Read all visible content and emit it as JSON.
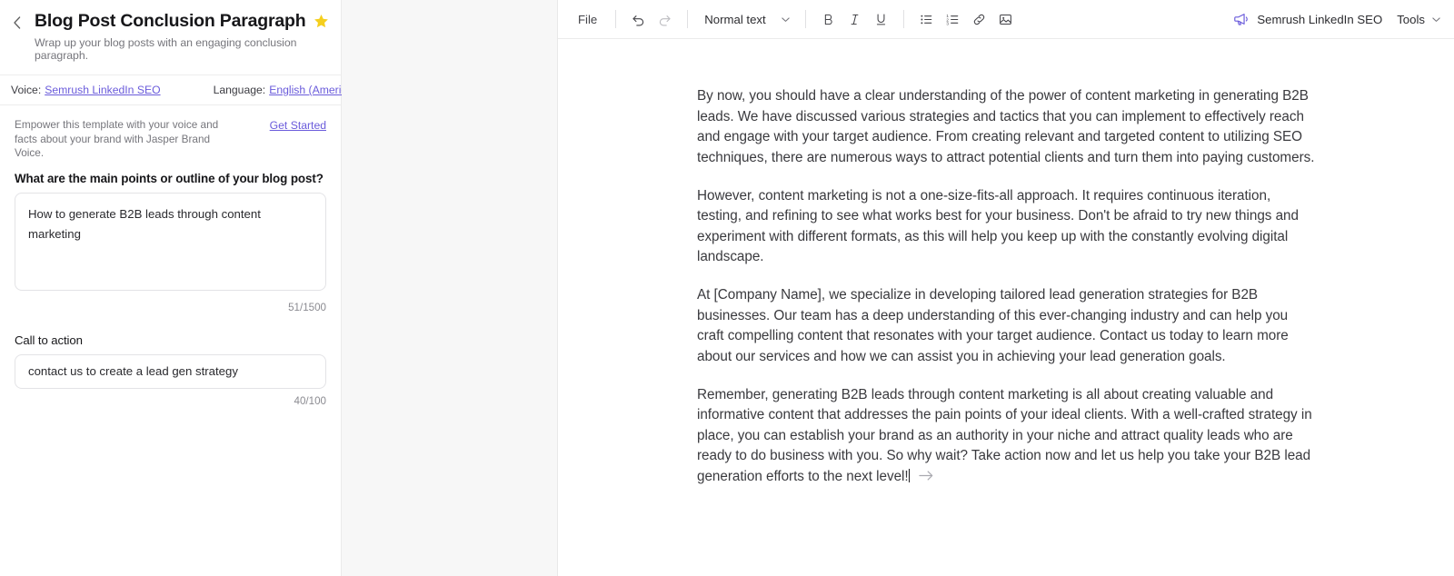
{
  "left_panel": {
    "back_label": "‹",
    "title": "Blog Post Conclusion Paragraph",
    "subtitle": "Wrap up your blog posts with an engaging conclusion paragraph.",
    "star_color": "#f5cf1e",
    "meta": {
      "voice_label": "Voice:",
      "voice_value": "Semrush LinkedIn SEO",
      "language_label": "Language:",
      "language_value": "English (American)"
    },
    "brand": {
      "description": "Empower this template with your voice and facts about your brand with Jasper Brand Voice.",
      "cta": "Get Started"
    },
    "fields": [
      {
        "label": "What are the main points or outline of your blog post?",
        "value": "How to generate B2B leads through content marketing",
        "placeholder": "",
        "counter": "51/1500"
      },
      {
        "label": "Call to action",
        "value": "contact us to create a lead gen strategy",
        "placeholder": "",
        "counter": "40/100"
      }
    ]
  },
  "toolbar": {
    "file_label": "File",
    "undo_name": "undo-icon",
    "redo_name": "redo-icon",
    "style_value": "Normal text",
    "bold_label": "B",
    "italic_label": "I",
    "underline_label": "U",
    "bullet_list_name": "bullet-list-icon",
    "numbered_list_name": "numbered-list-icon",
    "link_name": "link-icon",
    "image_name": "image-icon",
    "voice_chip_label": "Semrush LinkedIn SEO",
    "voice_chip_color": "#6a5bdb",
    "tools_label": "Tools"
  },
  "document": {
    "paragraphs": [
      "By now, you should have a clear understanding of the power of content marketing in generating B2B leads. We have discussed various strategies and tactics that you can implement to effectively reach and engage with your target audience. From creating relevant and targeted content to utilizing SEO techniques, there are numerous ways to attract potential clients and turn them into paying customers.",
      "However, content marketing is not a one-size-fits-all approach. It requires continuous iteration, testing, and refining to see what works best for your business. Don't be afraid to try new things and experiment with different formats, as this will help you keep up with the constantly evolving digital landscape.",
      "At [Company Name], we specialize in developing tailored lead generation strategies for B2B businesses. Our team has a deep understanding of this ever-changing industry and can help you craft compelling content that resonates with your target audience. Contact us today to learn more about our services and how we can assist you in achieving your lead generation goals.",
      "Remember, generating B2B leads through content marketing is all about creating valuable and informative content that addresses the pain points of your ideal clients. With a well-crafted strategy in place, you can establish your brand as an authority in your niche and attract quality leads who are ready to do business with you. So why wait? Take action now and let us help you take your B2B lead generation efforts to the next level!"
    ]
  }
}
